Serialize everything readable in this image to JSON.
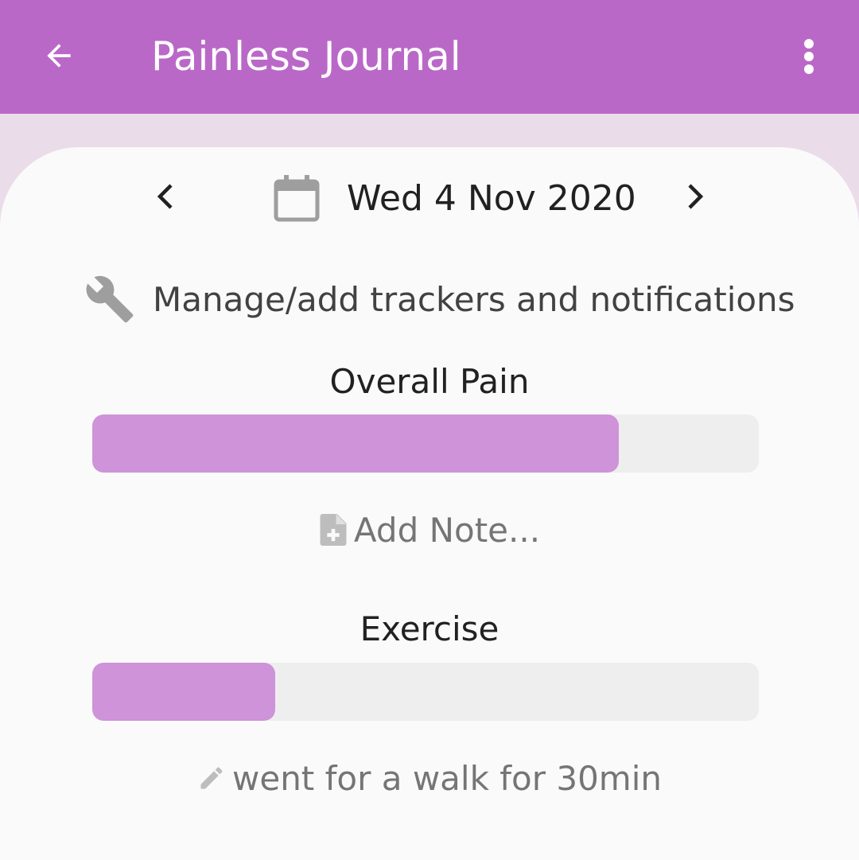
{
  "appbar": {
    "title": "Painless Journal",
    "back_icon": "arrow-back-icon",
    "menu_icon": "more-vert-icon"
  },
  "date_nav": {
    "date": "Wed 4 Nov 2020",
    "prev_icon": "chevron-left-icon",
    "next_icon": "chevron-right-icon",
    "calendar_icon": "calendar-icon"
  },
  "manage": {
    "label": "Manage/add trackers and notifications",
    "icon": "wrench-icon"
  },
  "trackers": [
    {
      "name": "Overall Pain",
      "level": 0.79,
      "note": "Add Note...",
      "note_icon": "note-add-icon"
    },
    {
      "name": "Exercise",
      "level": 0.275,
      "note": "went for a walk for 30min",
      "note_icon": "pencil-icon"
    }
  ],
  "colors": {
    "appbar": "#ba68c8",
    "fill": "#ce93d8",
    "track": "#eeeeee",
    "background": "#ebdcea",
    "card": "#fafafa"
  }
}
